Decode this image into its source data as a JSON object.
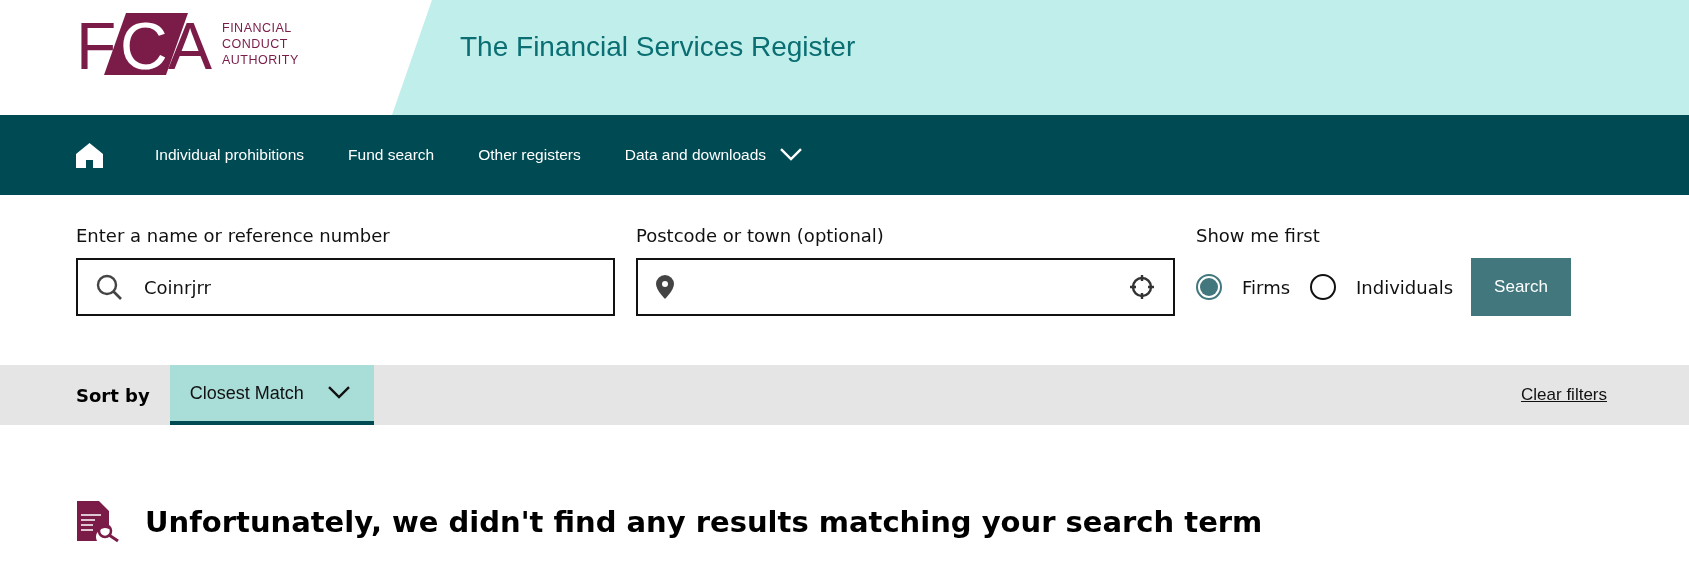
{
  "header": {
    "logo": {
      "mark": "FCA",
      "lines": [
        "FINANCIAL",
        "CONDUCT",
        "AUTHORITY"
      ]
    },
    "title": "The Financial Services Register"
  },
  "nav": {
    "items": [
      {
        "label": "Individual prohibitions",
        "dropdown": false
      },
      {
        "label": "Fund search",
        "dropdown": false
      },
      {
        "label": "Other registers",
        "dropdown": false
      },
      {
        "label": "Data and downloads",
        "dropdown": true
      }
    ]
  },
  "search": {
    "name_field": {
      "label": "Enter a name or reference number",
      "value": "Coinrjrr"
    },
    "location_field": {
      "label": "Postcode or town (optional)"
    },
    "show_me_first": {
      "label": "Show me first",
      "options": [
        {
          "label": "Firms",
          "selected": true
        },
        {
          "label": "Individuals",
          "selected": false
        }
      ]
    },
    "button": "Search"
  },
  "sort_bar": {
    "label": "Sort by",
    "value": "Closest Match",
    "clear": "Clear filters"
  },
  "results": {
    "message": "Unfortunately, we didn't find any results matching your search term"
  }
}
